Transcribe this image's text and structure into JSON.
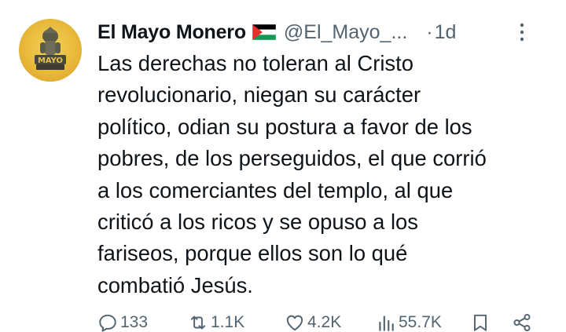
{
  "author": {
    "name": "El Mayo Monero",
    "flag": "palestine-flag-emoji",
    "handle": "@El_Mayo_...",
    "dot": "·",
    "time": "1d",
    "avatar_text": "MAYO"
  },
  "tweet": {
    "lines": [
      "Las derechas no toleran al Cristo",
      "revolucionario, niegan su carácter",
      "político, odian su postura a favor de los",
      "pobres, de los perseguidos, el que corrió",
      "a los comerciantes del templo, al que",
      "criticó a los ricos y se opuso a los",
      "fariseos, porque ellos son lo qué",
      "combatió Jesús."
    ]
  },
  "actions": {
    "replies": "133",
    "retweets": "1.1K",
    "likes": "4.2K",
    "views": "55.7K"
  },
  "colors": {
    "text": "#0f1419",
    "secondary": "#536471",
    "background": "#ffffff"
  }
}
